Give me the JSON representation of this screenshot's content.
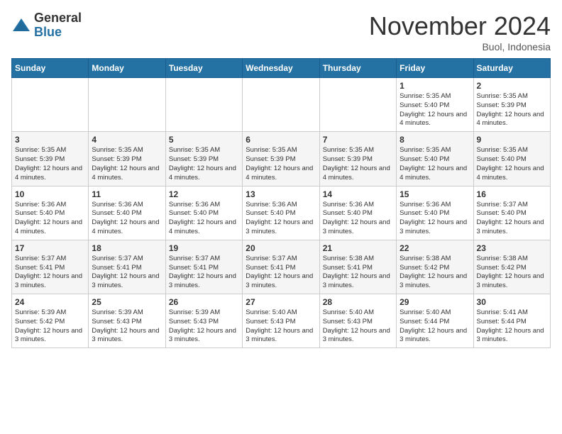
{
  "header": {
    "logo_general": "General",
    "logo_blue": "Blue",
    "month_title": "November 2024",
    "location": "Buol, Indonesia"
  },
  "weekdays": [
    "Sunday",
    "Monday",
    "Tuesday",
    "Wednesday",
    "Thursday",
    "Friday",
    "Saturday"
  ],
  "weeks": [
    [
      {
        "day": "",
        "info": ""
      },
      {
        "day": "",
        "info": ""
      },
      {
        "day": "",
        "info": ""
      },
      {
        "day": "",
        "info": ""
      },
      {
        "day": "",
        "info": ""
      },
      {
        "day": "1",
        "info": "Sunrise: 5:35 AM\nSunset: 5:40 PM\nDaylight: 12 hours and 4 minutes."
      },
      {
        "day": "2",
        "info": "Sunrise: 5:35 AM\nSunset: 5:39 PM\nDaylight: 12 hours and 4 minutes."
      }
    ],
    [
      {
        "day": "3",
        "info": "Sunrise: 5:35 AM\nSunset: 5:39 PM\nDaylight: 12 hours and 4 minutes."
      },
      {
        "day": "4",
        "info": "Sunrise: 5:35 AM\nSunset: 5:39 PM\nDaylight: 12 hours and 4 minutes."
      },
      {
        "day": "5",
        "info": "Sunrise: 5:35 AM\nSunset: 5:39 PM\nDaylight: 12 hours and 4 minutes."
      },
      {
        "day": "6",
        "info": "Sunrise: 5:35 AM\nSunset: 5:39 PM\nDaylight: 12 hours and 4 minutes."
      },
      {
        "day": "7",
        "info": "Sunrise: 5:35 AM\nSunset: 5:39 PM\nDaylight: 12 hours and 4 minutes."
      },
      {
        "day": "8",
        "info": "Sunrise: 5:35 AM\nSunset: 5:40 PM\nDaylight: 12 hours and 4 minutes."
      },
      {
        "day": "9",
        "info": "Sunrise: 5:35 AM\nSunset: 5:40 PM\nDaylight: 12 hours and 4 minutes."
      }
    ],
    [
      {
        "day": "10",
        "info": "Sunrise: 5:36 AM\nSunset: 5:40 PM\nDaylight: 12 hours and 4 minutes."
      },
      {
        "day": "11",
        "info": "Sunrise: 5:36 AM\nSunset: 5:40 PM\nDaylight: 12 hours and 4 minutes."
      },
      {
        "day": "12",
        "info": "Sunrise: 5:36 AM\nSunset: 5:40 PM\nDaylight: 12 hours and 4 minutes."
      },
      {
        "day": "13",
        "info": "Sunrise: 5:36 AM\nSunset: 5:40 PM\nDaylight: 12 hours and 3 minutes."
      },
      {
        "day": "14",
        "info": "Sunrise: 5:36 AM\nSunset: 5:40 PM\nDaylight: 12 hours and 3 minutes."
      },
      {
        "day": "15",
        "info": "Sunrise: 5:36 AM\nSunset: 5:40 PM\nDaylight: 12 hours and 3 minutes."
      },
      {
        "day": "16",
        "info": "Sunrise: 5:37 AM\nSunset: 5:40 PM\nDaylight: 12 hours and 3 minutes."
      }
    ],
    [
      {
        "day": "17",
        "info": "Sunrise: 5:37 AM\nSunset: 5:41 PM\nDaylight: 12 hours and 3 minutes."
      },
      {
        "day": "18",
        "info": "Sunrise: 5:37 AM\nSunset: 5:41 PM\nDaylight: 12 hours and 3 minutes."
      },
      {
        "day": "19",
        "info": "Sunrise: 5:37 AM\nSunset: 5:41 PM\nDaylight: 12 hours and 3 minutes."
      },
      {
        "day": "20",
        "info": "Sunrise: 5:37 AM\nSunset: 5:41 PM\nDaylight: 12 hours and 3 minutes."
      },
      {
        "day": "21",
        "info": "Sunrise: 5:38 AM\nSunset: 5:41 PM\nDaylight: 12 hours and 3 minutes."
      },
      {
        "day": "22",
        "info": "Sunrise: 5:38 AM\nSunset: 5:42 PM\nDaylight: 12 hours and 3 minutes."
      },
      {
        "day": "23",
        "info": "Sunrise: 5:38 AM\nSunset: 5:42 PM\nDaylight: 12 hours and 3 minutes."
      }
    ],
    [
      {
        "day": "24",
        "info": "Sunrise: 5:39 AM\nSunset: 5:42 PM\nDaylight: 12 hours and 3 minutes."
      },
      {
        "day": "25",
        "info": "Sunrise: 5:39 AM\nSunset: 5:43 PM\nDaylight: 12 hours and 3 minutes."
      },
      {
        "day": "26",
        "info": "Sunrise: 5:39 AM\nSunset: 5:43 PM\nDaylight: 12 hours and 3 minutes."
      },
      {
        "day": "27",
        "info": "Sunrise: 5:40 AM\nSunset: 5:43 PM\nDaylight: 12 hours and 3 minutes."
      },
      {
        "day": "28",
        "info": "Sunrise: 5:40 AM\nSunset: 5:43 PM\nDaylight: 12 hours and 3 minutes."
      },
      {
        "day": "29",
        "info": "Sunrise: 5:40 AM\nSunset: 5:44 PM\nDaylight: 12 hours and 3 minutes."
      },
      {
        "day": "30",
        "info": "Sunrise: 5:41 AM\nSunset: 5:44 PM\nDaylight: 12 hours and 3 minutes."
      }
    ]
  ]
}
